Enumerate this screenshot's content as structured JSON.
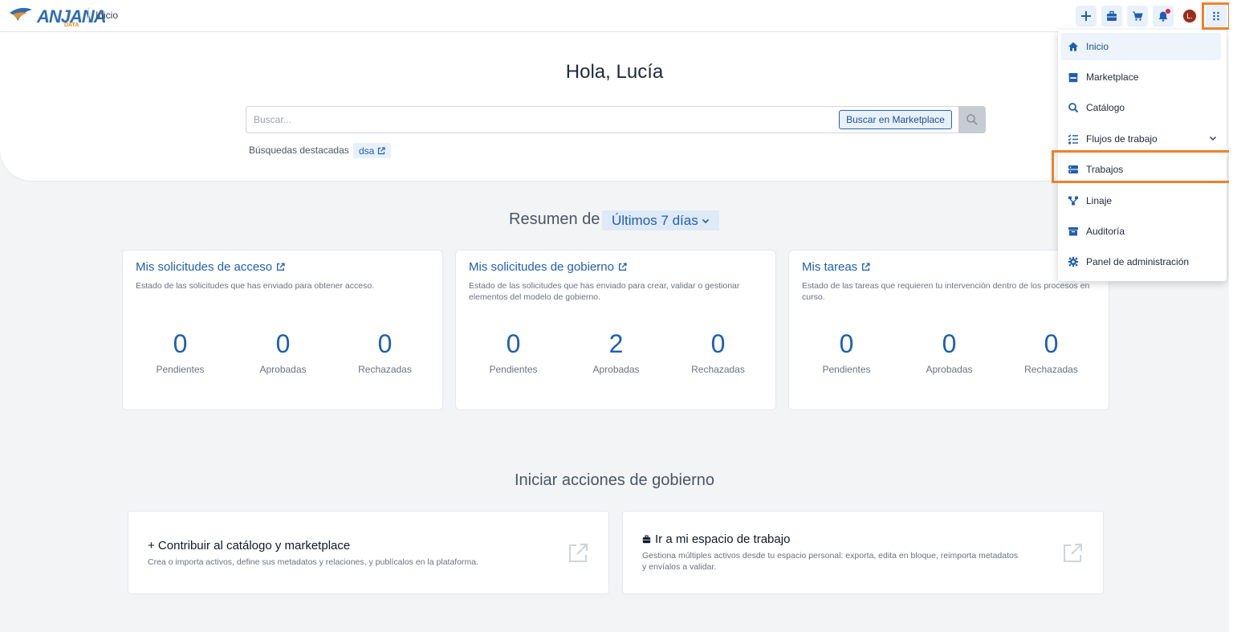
{
  "header": {
    "logo_text": "ANJANA",
    "logo_sub": "DATA",
    "breadcrumb": "Inicio",
    "user_initial": "L."
  },
  "hero": {
    "greeting": "Hola, Lucía",
    "search_placeholder": "Buscar...",
    "search_button": "Buscar en Marketplace",
    "featured_label": "Búsquedas destacadas",
    "featured_chip": "dsa"
  },
  "summary": {
    "title": "Resumen de",
    "period": "Últimos 7 días",
    "cards": [
      {
        "title": "Mis solicitudes de acceso",
        "desc": "Estado de las solicitudes que has enviado para obtener acceso.",
        "stats": [
          {
            "value": "0",
            "label": "Pendientes"
          },
          {
            "value": "0",
            "label": "Aprobadas"
          },
          {
            "value": "0",
            "label": "Rechazadas"
          }
        ]
      },
      {
        "title": "Mis solicitudes de gobierno",
        "desc": "Estado de las solicitudes que has enviado para crear, validar o gestionar elementos del modelo de gobierno.",
        "stats": [
          {
            "value": "0",
            "label": "Pendientes"
          },
          {
            "value": "2",
            "label": "Aprobadas"
          },
          {
            "value": "0",
            "label": "Rechazadas"
          }
        ]
      },
      {
        "title": "Mis tareas",
        "desc": "Estado de las tareas que requieren tu intervención dentro de los procesos en curso.",
        "stats": [
          {
            "value": "0",
            "label": "Pendientes"
          },
          {
            "value": "0",
            "label": "Aprobadas"
          },
          {
            "value": "0",
            "label": "Rechazadas"
          }
        ]
      }
    ]
  },
  "actions": {
    "title": "Iniciar acciones de gobierno",
    "items": [
      {
        "title": "+ Contribuir al catálogo y marketplace",
        "desc": "Crea o importa activos, define sus metadatos y relaciones, y publícalos en la plataforma."
      },
      {
        "title": "Ir a mi espacio de trabajo",
        "desc": "Gestiona múltiples activos desde tu espacio personal: exporta, edita en bloque, reimporta metadatos y envíalos a validar."
      }
    ]
  },
  "menu": {
    "items": [
      {
        "label": "Inicio",
        "icon": "home-icon"
      },
      {
        "label": "Marketplace",
        "icon": "store-icon"
      },
      {
        "label": "Catálogo",
        "icon": "search-icon"
      },
      {
        "label": "Flujos de trabajo",
        "icon": "checklist-icon"
      },
      {
        "label": "Trabajos",
        "icon": "server-icon"
      },
      {
        "label": "Linaje",
        "icon": "lineage-icon"
      },
      {
        "label": "Auditoría",
        "icon": "archive-icon"
      },
      {
        "label": "Panel de administración",
        "icon": "gear-icon"
      }
    ]
  },
  "colors": {
    "accent": "#1f5fb0",
    "highlight": "#f0802c"
  }
}
